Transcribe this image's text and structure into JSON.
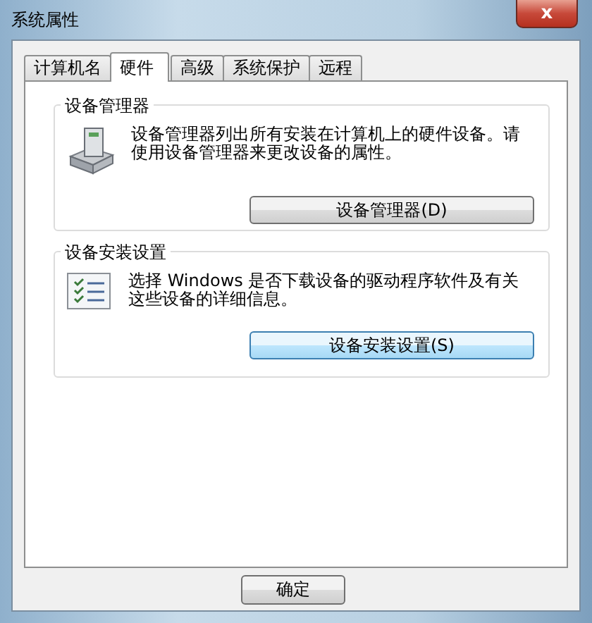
{
  "window": {
    "title": "系统属性",
    "close": "x"
  },
  "tabs": [
    {
      "label": "计算机名",
      "selected": false
    },
    {
      "label": "硬件",
      "selected": true
    },
    {
      "label": "高级",
      "selected": false
    },
    {
      "label": "系统保护",
      "selected": false
    },
    {
      "label": "远程",
      "selected": false
    }
  ],
  "groups": [
    {
      "kind": "device-manager",
      "title": "设备管理器",
      "description": "设备管理器列出所有安装在计算机上的硬件设备。请使用设备管理器来更改设备的属性。",
      "button": {
        "label": "设备管理器(D)",
        "focused": false
      }
    },
    {
      "kind": "install-settings",
      "title": "设备安装设置",
      "description": "选择 Windows 是否下载设备的驱动程序软件及有关这些设备的详细信息。",
      "button": {
        "label": "设备安装设置(S)",
        "focused": true
      }
    }
  ],
  "buttons": [
    "确定"
  ]
}
